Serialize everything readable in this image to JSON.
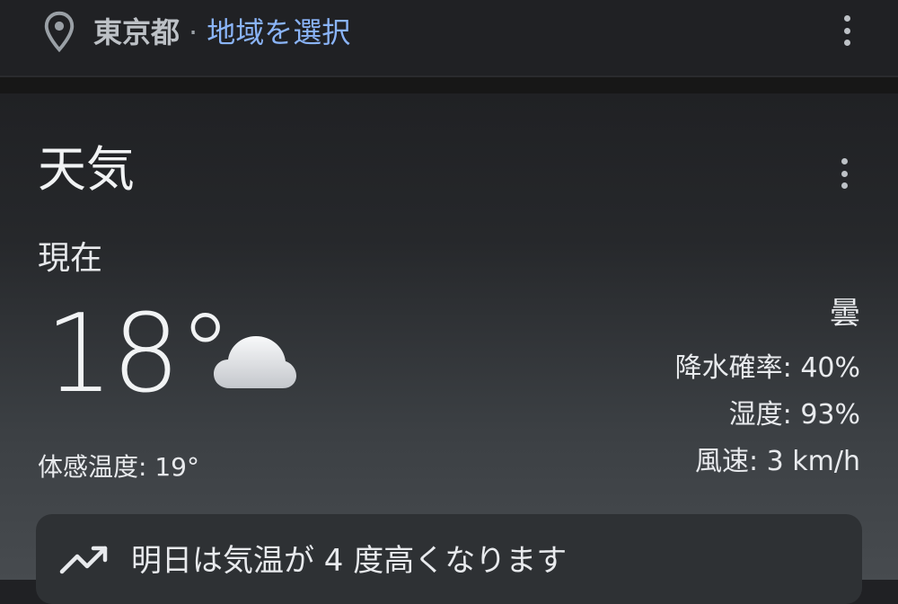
{
  "location": {
    "pin_icon": "location-pin-icon",
    "city": "東京都",
    "separator": "·",
    "select_region_link": "地域を選択"
  },
  "weather_card": {
    "title": "天気",
    "now_label": "現在",
    "temperature": "18°",
    "condition_icon": "cloud-icon",
    "feels_like": "体感温度: 19°",
    "condition": "曇",
    "precipitation": "降水確率: 40%",
    "humidity": "湿度: 93%",
    "wind": "風速: 3 km/h",
    "forecast_note": {
      "icon": "trending-up-icon",
      "text": "明日は気温が 4 度高くなります"
    }
  },
  "colors": {
    "background": "#202124",
    "link": "#8ab4f8",
    "text": "#e8eaed",
    "forecast_box": "#2e3134"
  }
}
